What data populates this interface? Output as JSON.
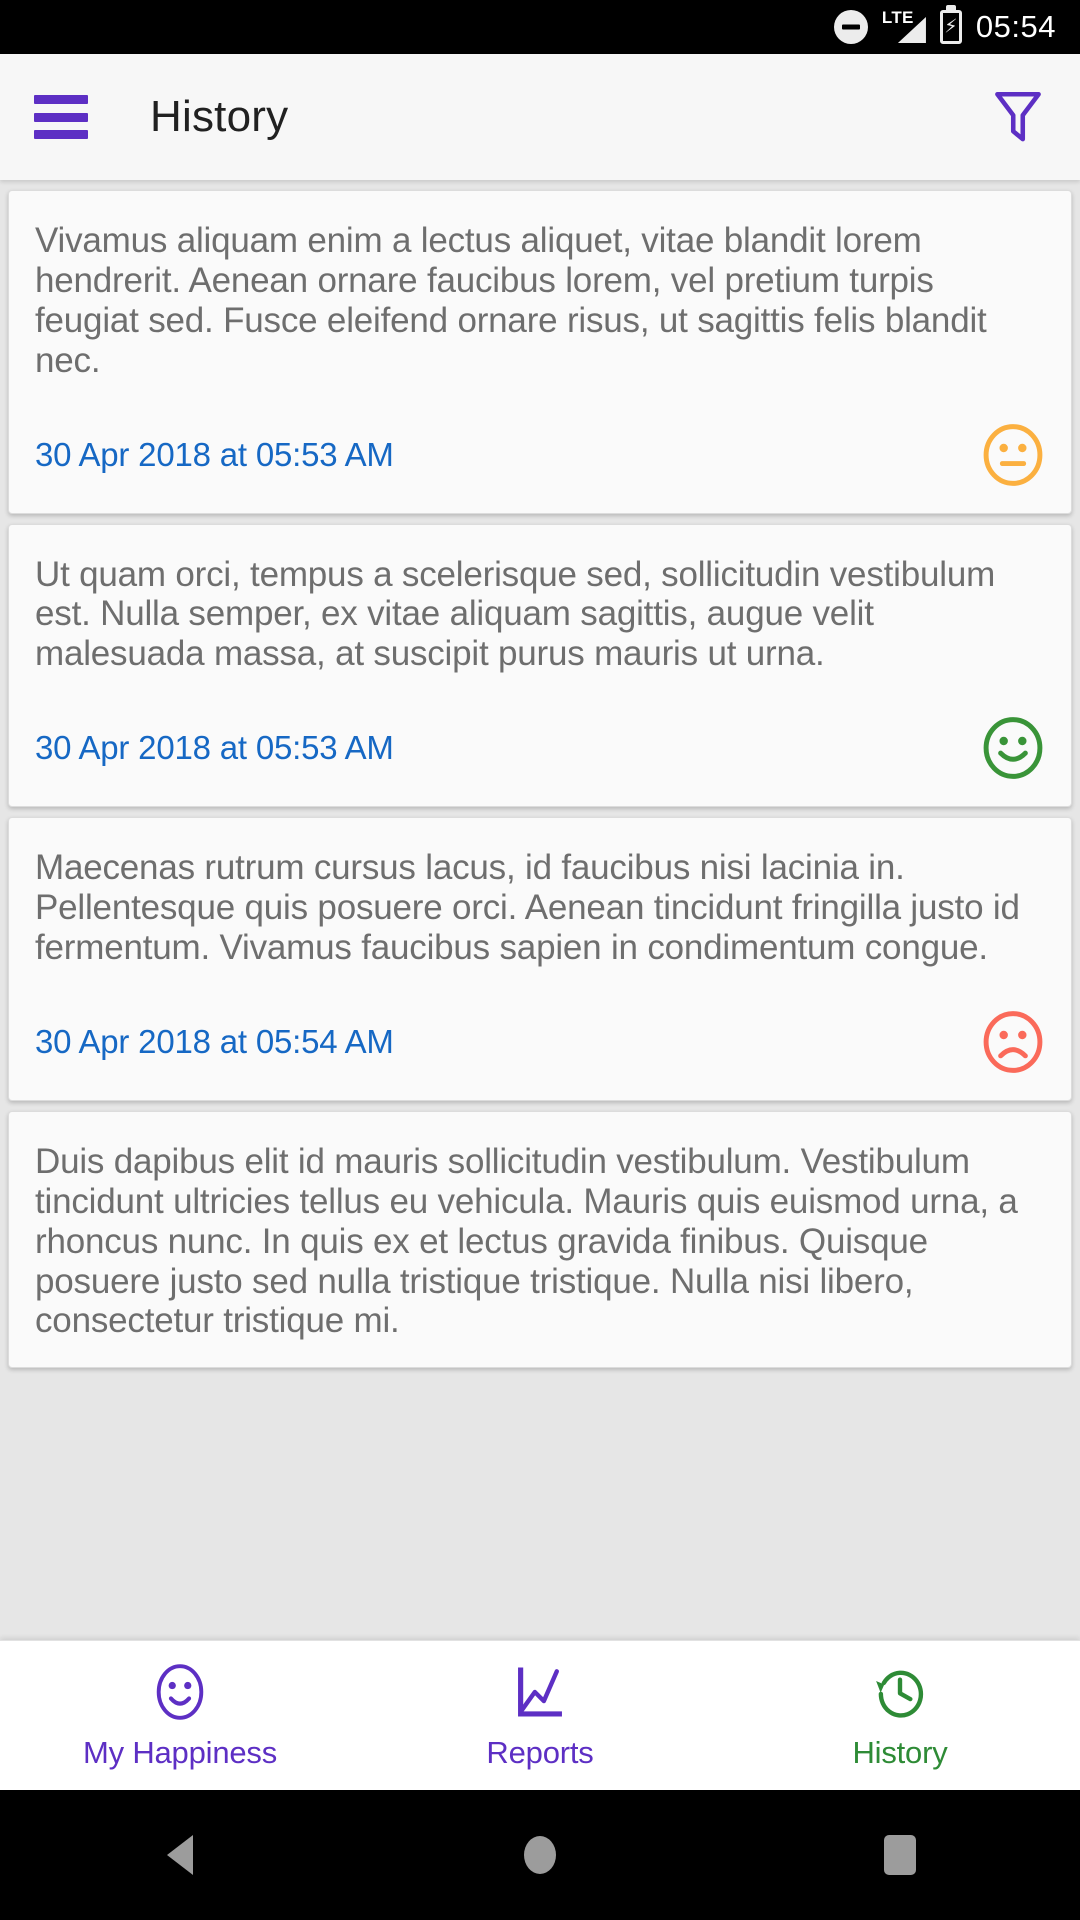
{
  "status_bar": {
    "dnd_icon": "do-not-disturb-icon",
    "network_label": "LTE",
    "signal_icon": "signal-bars-icon",
    "battery_icon": "battery-charging-icon",
    "time": "05:54"
  },
  "app_bar": {
    "menu_icon": "hamburger-menu-icon",
    "title": "History",
    "filter_icon": "filter-funnel-icon",
    "accent_color": "#5d2fc4"
  },
  "colors": {
    "mood_neutral": "#fbb040",
    "mood_happy": "#399438",
    "mood_sad": "#fa6a5a",
    "date_blue": "#1668c4",
    "body_text": "#6e6e6e",
    "nav_active": "#2e8b36",
    "nav_inactive": "#5d2fc4"
  },
  "entries": [
    {
      "text": "Vivamus aliquam enim a lectus aliquet, vitae blandit lorem hendrerit. Aenean ornare faucibus lorem, vel pretium turpis feugiat sed. Fusce eleifend ornare risus, ut sagittis felis blandit nec.",
      "date": "30 Apr 2018 at 05:53 AM",
      "mood": "neutral",
      "mood_icon": "neutral-face-icon"
    },
    {
      "text": "Ut quam orci, tempus a scelerisque sed, sollicitudin vestibulum est. Nulla semper, ex vitae aliquam sagittis, augue velit malesuada massa, at suscipit purus mauris ut urna.",
      "date": "30 Apr 2018 at 05:53 AM",
      "mood": "happy",
      "mood_icon": "happy-face-icon"
    },
    {
      "text": "Maecenas rutrum cursus lacus, id faucibus nisi lacinia in. Pellentesque quis posuere orci. Aenean tincidunt fringilla justo id fermentum. Vivamus faucibus sapien in condimentum congue.",
      "date": "30 Apr 2018 at 05:54 AM",
      "mood": "sad",
      "mood_icon": "sad-face-icon"
    },
    {
      "text": "Duis dapibus elit id mauris sollicitudin vestibulum. Vestibulum tincidunt ultricies tellus eu vehicula. Mauris quis euismod urna, a rhoncus nunc. In quis ex et lectus gravida finibus. Quisque posuere justo sed nulla tristique tristique. Nulla nisi libero, consectetur tristique mi.",
      "date": "",
      "mood": "",
      "mood_icon": ""
    }
  ],
  "bottom_nav": {
    "items": [
      {
        "label": "My Happiness",
        "icon": "smiley-face-icon",
        "active": false
      },
      {
        "label": "Reports",
        "icon": "line-chart-icon",
        "active": false
      },
      {
        "label": "History",
        "icon": "history-clock-icon",
        "active": true
      }
    ]
  },
  "system_nav": {
    "back": "back-triangle-icon",
    "home": "home-circle-icon",
    "recents": "recents-square-icon"
  }
}
